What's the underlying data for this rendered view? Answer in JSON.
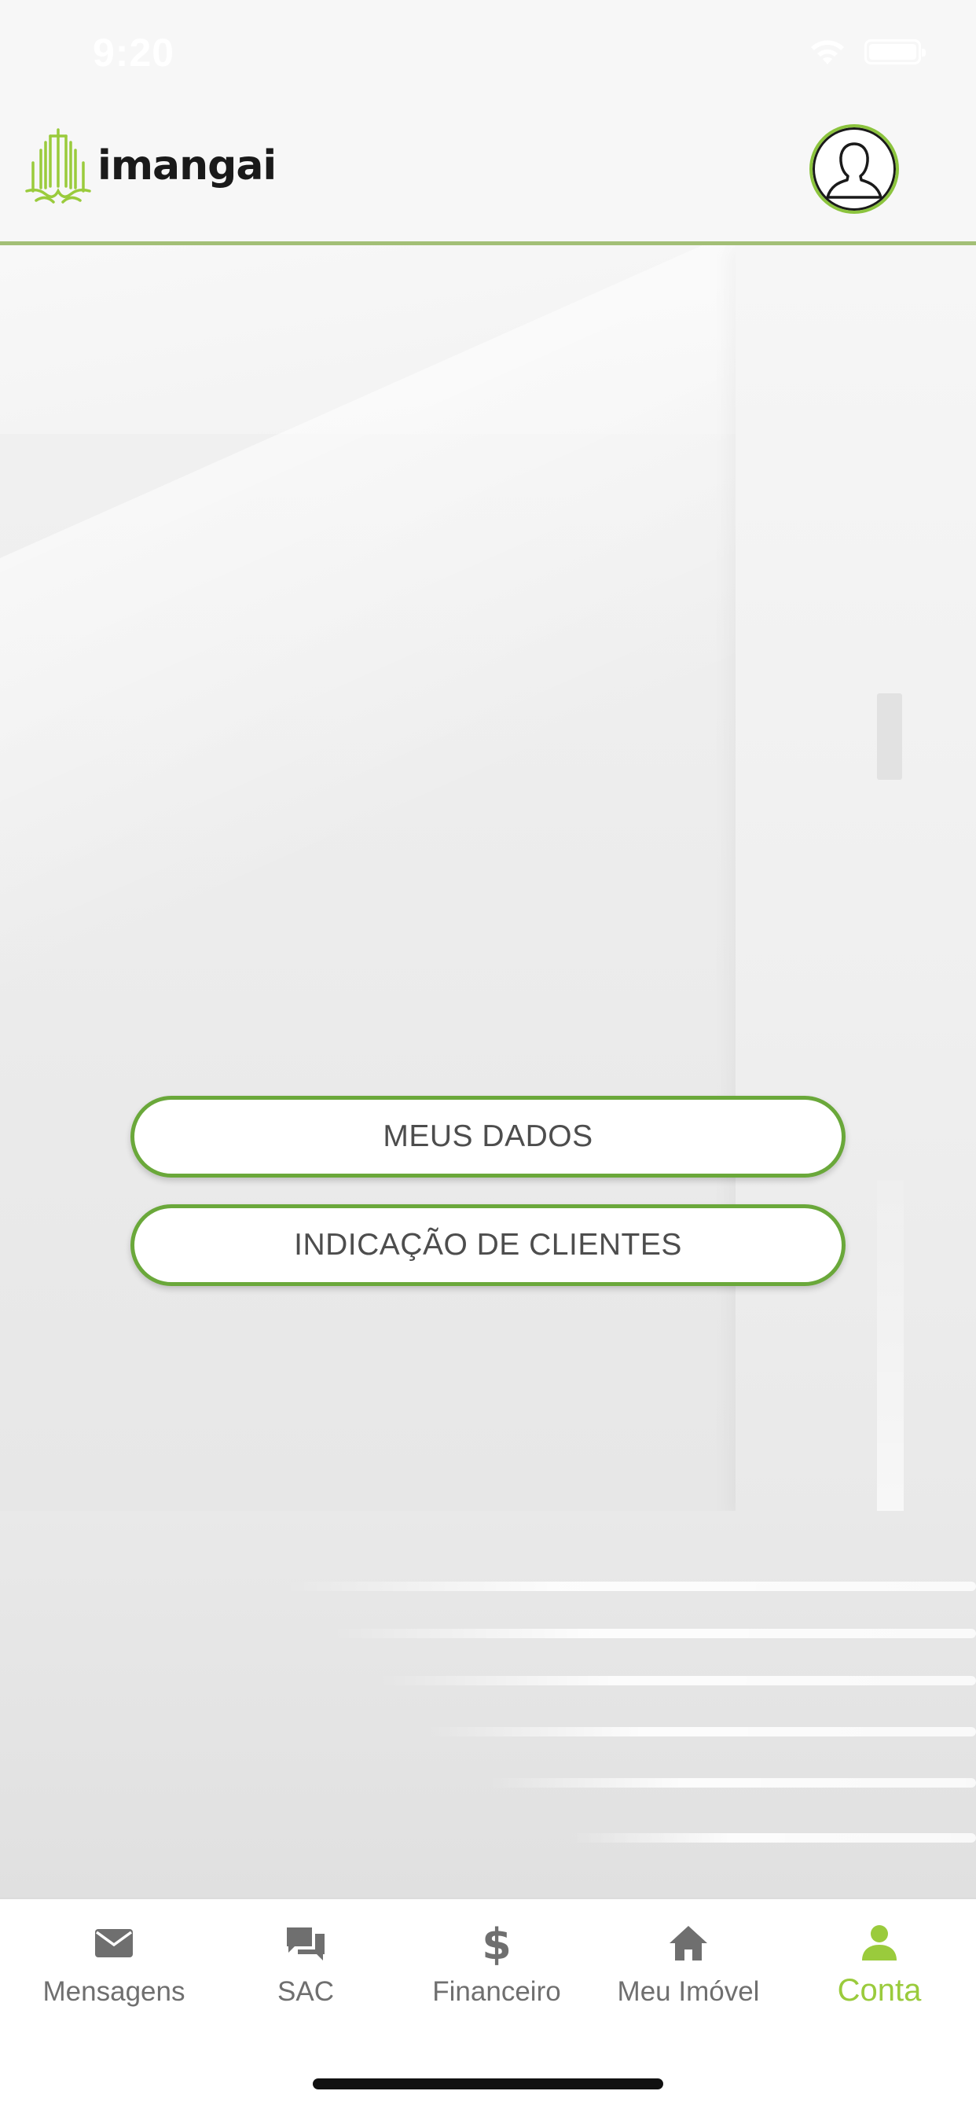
{
  "status_bar": {
    "time": "9:20"
  },
  "header": {
    "logo_text": "imangai"
  },
  "menu": {
    "meus_dados": "MEUS DADOS",
    "indicacao_clientes": "INDICAÇÃO DE CLIENTES"
  },
  "tabs": [
    {
      "label": "Mensagens",
      "icon": "mail-icon",
      "active": false
    },
    {
      "label": "SAC",
      "icon": "chat-icon",
      "active": false
    },
    {
      "label": "Financeiro",
      "icon": "dollar-icon",
      "active": false
    },
    {
      "label": "Meu Imóvel",
      "icon": "home-icon",
      "active": false
    },
    {
      "label": "Conta",
      "icon": "person-icon",
      "active": true
    }
  ],
  "colors": {
    "accent": "#9acb3c",
    "button_border": "#6aa83a",
    "header_divider": "#a3bf76",
    "tab_inactive": "#6f6f6f"
  }
}
